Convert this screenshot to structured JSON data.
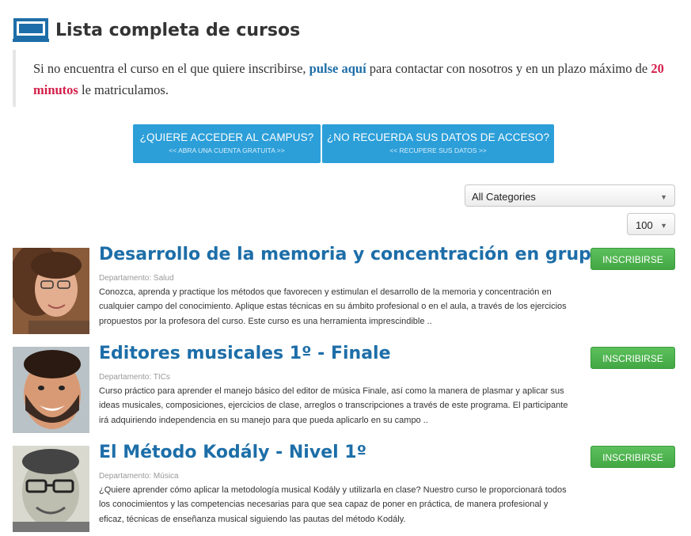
{
  "header": {
    "title": "Lista completa de cursos",
    "icon": "blackboard-icon"
  },
  "notice": {
    "text_before": "Si no encuentra el curso en el que quiere inscribirse, ",
    "link": "pulse aquí",
    "text_middle": " para contactar con nosotros y en un plazo máximo de ",
    "highlight": "20 minutos",
    "text_after": " le matriculamos."
  },
  "buttons": {
    "campus_main": "¿QUIERE ACCEDER AL CAMPUS?",
    "campus_sub": "<< ABRA UNA CUENTA GRATUITA >>",
    "recover_main": "¿NO RECUERDA SUS DATOS DE ACCESO?",
    "recover_sub": "<< RECUPERE SUS DATOS >>"
  },
  "filters": {
    "category": "All Categories",
    "per_page": "100"
  },
  "courses": [
    {
      "title": "Desarrollo de la memoria y concentración en grupo",
      "department": "Departamento: Salud",
      "description": "Conozca, aprenda y practique los métodos que favorecen y estimulan el desarrollo de la memoria y concentración en cualquier campo del conocimiento. Aplique estas técnicas en su ámbito profesional o en el aula, a través de los ejercicios propuestos por la profesora del curso. Este curso es una herramienta imprescindible ..",
      "enroll": "INSCRIBIRSE"
    },
    {
      "title": "Editores musicales 1º - Finale",
      "department": "Departamento: TICs",
      "description": "Curso práctico para aprender el manejo básico del editor de música Finale, así como la manera de plasmar y aplicar sus ideas musicales, composiciones, ejercicios de clase, arreglos o transcripciones a través de este programa. El participante irá adquiriendo independencia en su manejo para que pueda aplicarlo en su campo ..",
      "enroll": "INSCRIBIRSE"
    },
    {
      "title": "El Método Kodály - Nivel 1º",
      "department": "Departamento: Música",
      "description": "¿Quiere aprender cómo aplicar la metodología musical Kodály y utilizarla en clase? Nuestro curso le proporcionará todos los conocimientos y las competencias necesarias para que sea capaz de poner en práctica, de manera profesional y eficaz, técnicas de enseñanza musical siguiendo las pautas del método Kodály.",
      "enroll": "INSCRIBIRSE"
    }
  ],
  "colors": {
    "accent": "#1d6ea8",
    "button_blue": "#2c9fd9",
    "button_green": "#4cae4c",
    "highlight_red": "#d21f4a"
  }
}
